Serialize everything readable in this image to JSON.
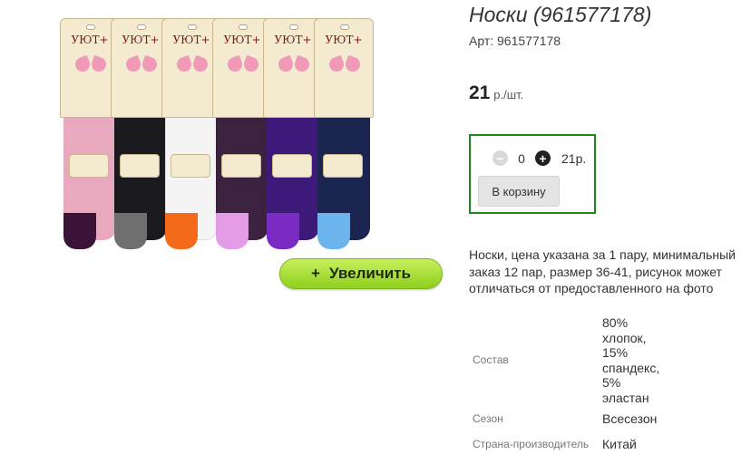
{
  "product": {
    "title": "Носки (961577178)",
    "article_label": "Арт:",
    "article_value": "961577178",
    "price": "21",
    "price_unit": "р./шт.",
    "description": "Носки, цена указана за 1 пару, минимальный заказ 12 пар, размер 36-41, рисунок может отличаться от предоставленного на фото"
  },
  "image": {
    "brand": "УЮТ+",
    "zoom_label": "Увеличить",
    "zoom_icon": "plus-icon",
    "sock_colors": [
      "#e8a8bd",
      "#1b1b1f",
      "#f4f4f4",
      "#3b2340",
      "#3d1a7a",
      "#1a2550"
    ],
    "heel_colors": [
      "#3a1338",
      "#6f6f6f",
      "#f26a1a",
      "#e49be6",
      "#7a2bc4",
      "#6cb4ee"
    ]
  },
  "cart": {
    "minus_icon": "minus-icon",
    "plus_icon": "plus-icon",
    "quantity": "0",
    "total": "21р.",
    "add_button": "В корзину",
    "border_color": "#1b8a1b"
  },
  "properties": [
    {
      "name": "Состав",
      "value": "80%\nхлопок,\n15%\nспандекс,\n5%\nэластан"
    },
    {
      "name": "Сезон",
      "value": "Всесезон"
    },
    {
      "name": "Страна-производитель",
      "value": "Китай"
    }
  ]
}
